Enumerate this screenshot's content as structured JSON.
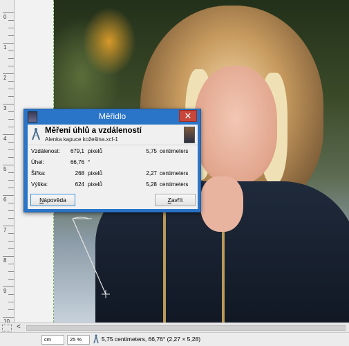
{
  "ruler": {
    "labels": [
      "0",
      "1",
      "2",
      "3",
      "4",
      "5",
      "6",
      "7",
      "8",
      "9",
      "10"
    ]
  },
  "dialog": {
    "title": "Měřidlo",
    "close_symbol": "✕",
    "heading": "Měření úhlů a vzdáleností",
    "subheading": "Alenka kapuce kožešina.xcf-1",
    "rows": [
      {
        "label": "Vzdálenost:",
        "value1": "679,1",
        "unit1": "pixelů",
        "value2": "5,75",
        "unit2": "centimeters"
      },
      {
        "label": "Úhel:",
        "value1": "66,76",
        "unit1": "°",
        "value2": "",
        "unit2": ""
      },
      {
        "label": "Šířka:",
        "value1": "268",
        "unit1": "pixelů",
        "value2": "2,27",
        "unit2": "centimeters"
      },
      {
        "label": "Výška:",
        "value1": "624",
        "unit1": "pixelů",
        "value2": "5,28",
        "unit2": "centimeters"
      }
    ],
    "help_button_pre": "N",
    "help_button_rest": "ápověda",
    "close_button_pre": "Z",
    "close_button_rest": "avřít"
  },
  "scrollbar": {
    "left_arrow": "<"
  },
  "statusbar": {
    "unit": "cm",
    "zoom": "25 %",
    "message": "5,75 centimeters, 66,76° (2,27 × 5,28)"
  },
  "icons": {
    "dialog_app": "gimp-wilber-icon",
    "measure": "compass-icon",
    "close": "close-icon"
  },
  "colors": {
    "titlebar": "#2a75c8",
    "close_button": "#c8463a",
    "guide": "#6cae5d"
  }
}
